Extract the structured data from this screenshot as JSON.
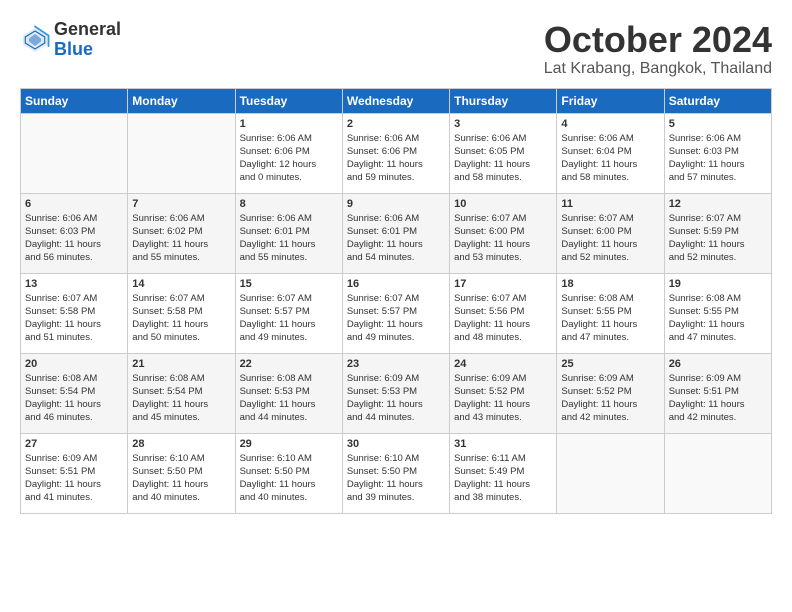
{
  "logo": {
    "line1": "General",
    "line2": "Blue"
  },
  "title": "October 2024",
  "location": "Lat Krabang, Bangkok, Thailand",
  "headers": [
    "Sunday",
    "Monday",
    "Tuesday",
    "Wednesday",
    "Thursday",
    "Friday",
    "Saturday"
  ],
  "weeks": [
    [
      {
        "day": "",
        "info": ""
      },
      {
        "day": "",
        "info": ""
      },
      {
        "day": "1",
        "info": "Sunrise: 6:06 AM\nSunset: 6:06 PM\nDaylight: 12 hours\nand 0 minutes."
      },
      {
        "day": "2",
        "info": "Sunrise: 6:06 AM\nSunset: 6:06 PM\nDaylight: 11 hours\nand 59 minutes."
      },
      {
        "day": "3",
        "info": "Sunrise: 6:06 AM\nSunset: 6:05 PM\nDaylight: 11 hours\nand 58 minutes."
      },
      {
        "day": "4",
        "info": "Sunrise: 6:06 AM\nSunset: 6:04 PM\nDaylight: 11 hours\nand 58 minutes."
      },
      {
        "day": "5",
        "info": "Sunrise: 6:06 AM\nSunset: 6:03 PM\nDaylight: 11 hours\nand 57 minutes."
      }
    ],
    [
      {
        "day": "6",
        "info": "Sunrise: 6:06 AM\nSunset: 6:03 PM\nDaylight: 11 hours\nand 56 minutes."
      },
      {
        "day": "7",
        "info": "Sunrise: 6:06 AM\nSunset: 6:02 PM\nDaylight: 11 hours\nand 55 minutes."
      },
      {
        "day": "8",
        "info": "Sunrise: 6:06 AM\nSunset: 6:01 PM\nDaylight: 11 hours\nand 55 minutes."
      },
      {
        "day": "9",
        "info": "Sunrise: 6:06 AM\nSunset: 6:01 PM\nDaylight: 11 hours\nand 54 minutes."
      },
      {
        "day": "10",
        "info": "Sunrise: 6:07 AM\nSunset: 6:00 PM\nDaylight: 11 hours\nand 53 minutes."
      },
      {
        "day": "11",
        "info": "Sunrise: 6:07 AM\nSunset: 6:00 PM\nDaylight: 11 hours\nand 52 minutes."
      },
      {
        "day": "12",
        "info": "Sunrise: 6:07 AM\nSunset: 5:59 PM\nDaylight: 11 hours\nand 52 minutes."
      }
    ],
    [
      {
        "day": "13",
        "info": "Sunrise: 6:07 AM\nSunset: 5:58 PM\nDaylight: 11 hours\nand 51 minutes."
      },
      {
        "day": "14",
        "info": "Sunrise: 6:07 AM\nSunset: 5:58 PM\nDaylight: 11 hours\nand 50 minutes."
      },
      {
        "day": "15",
        "info": "Sunrise: 6:07 AM\nSunset: 5:57 PM\nDaylight: 11 hours\nand 49 minutes."
      },
      {
        "day": "16",
        "info": "Sunrise: 6:07 AM\nSunset: 5:57 PM\nDaylight: 11 hours\nand 49 minutes."
      },
      {
        "day": "17",
        "info": "Sunrise: 6:07 AM\nSunset: 5:56 PM\nDaylight: 11 hours\nand 48 minutes."
      },
      {
        "day": "18",
        "info": "Sunrise: 6:08 AM\nSunset: 5:55 PM\nDaylight: 11 hours\nand 47 minutes."
      },
      {
        "day": "19",
        "info": "Sunrise: 6:08 AM\nSunset: 5:55 PM\nDaylight: 11 hours\nand 47 minutes."
      }
    ],
    [
      {
        "day": "20",
        "info": "Sunrise: 6:08 AM\nSunset: 5:54 PM\nDaylight: 11 hours\nand 46 minutes."
      },
      {
        "day": "21",
        "info": "Sunrise: 6:08 AM\nSunset: 5:54 PM\nDaylight: 11 hours\nand 45 minutes."
      },
      {
        "day": "22",
        "info": "Sunrise: 6:08 AM\nSunset: 5:53 PM\nDaylight: 11 hours\nand 44 minutes."
      },
      {
        "day": "23",
        "info": "Sunrise: 6:09 AM\nSunset: 5:53 PM\nDaylight: 11 hours\nand 44 minutes."
      },
      {
        "day": "24",
        "info": "Sunrise: 6:09 AM\nSunset: 5:52 PM\nDaylight: 11 hours\nand 43 minutes."
      },
      {
        "day": "25",
        "info": "Sunrise: 6:09 AM\nSunset: 5:52 PM\nDaylight: 11 hours\nand 42 minutes."
      },
      {
        "day": "26",
        "info": "Sunrise: 6:09 AM\nSunset: 5:51 PM\nDaylight: 11 hours\nand 42 minutes."
      }
    ],
    [
      {
        "day": "27",
        "info": "Sunrise: 6:09 AM\nSunset: 5:51 PM\nDaylight: 11 hours\nand 41 minutes."
      },
      {
        "day": "28",
        "info": "Sunrise: 6:10 AM\nSunset: 5:50 PM\nDaylight: 11 hours\nand 40 minutes."
      },
      {
        "day": "29",
        "info": "Sunrise: 6:10 AM\nSunset: 5:50 PM\nDaylight: 11 hours\nand 40 minutes."
      },
      {
        "day": "30",
        "info": "Sunrise: 6:10 AM\nSunset: 5:50 PM\nDaylight: 11 hours\nand 39 minutes."
      },
      {
        "day": "31",
        "info": "Sunrise: 6:11 AM\nSunset: 5:49 PM\nDaylight: 11 hours\nand 38 minutes."
      },
      {
        "day": "",
        "info": ""
      },
      {
        "day": "",
        "info": ""
      }
    ]
  ]
}
